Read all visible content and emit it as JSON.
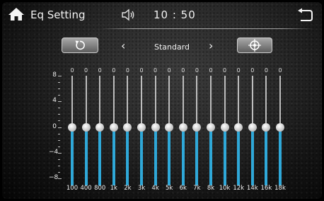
{
  "header": {
    "title": "Eq Setting",
    "time": "10 : 50",
    "home_icon": "home-icon",
    "speaker_icon": "speaker-icon",
    "back_icon": "back-return-icon"
  },
  "controls": {
    "reset_icon": "reset-icon",
    "prev_symbol": "‹",
    "preset_name": "Standard",
    "next_symbol": "›",
    "target_icon": "crosshair-icon"
  },
  "scale": {
    "labels": [
      "8",
      "4",
      "0",
      "−4",
      "−8"
    ]
  },
  "accent_color": "#2fa8d8",
  "bands": [
    {
      "freq": "100",
      "value": "0"
    },
    {
      "freq": "400",
      "value": "0"
    },
    {
      "freq": "800",
      "value": "0"
    },
    {
      "freq": "1k",
      "value": "0"
    },
    {
      "freq": "2k",
      "value": "0"
    },
    {
      "freq": "3k",
      "value": "0"
    },
    {
      "freq": "4k",
      "value": "0"
    },
    {
      "freq": "5k",
      "value": "0"
    },
    {
      "freq": "6k",
      "value": "0"
    },
    {
      "freq": "7k",
      "value": "0"
    },
    {
      "freq": "8k",
      "value": "0"
    },
    {
      "freq": "10k",
      "value": "0"
    },
    {
      "freq": "12k",
      "value": "0"
    },
    {
      "freq": "14k",
      "value": "0"
    },
    {
      "freq": "16k",
      "value": "0"
    },
    {
      "freq": "18k",
      "value": "0"
    }
  ]
}
